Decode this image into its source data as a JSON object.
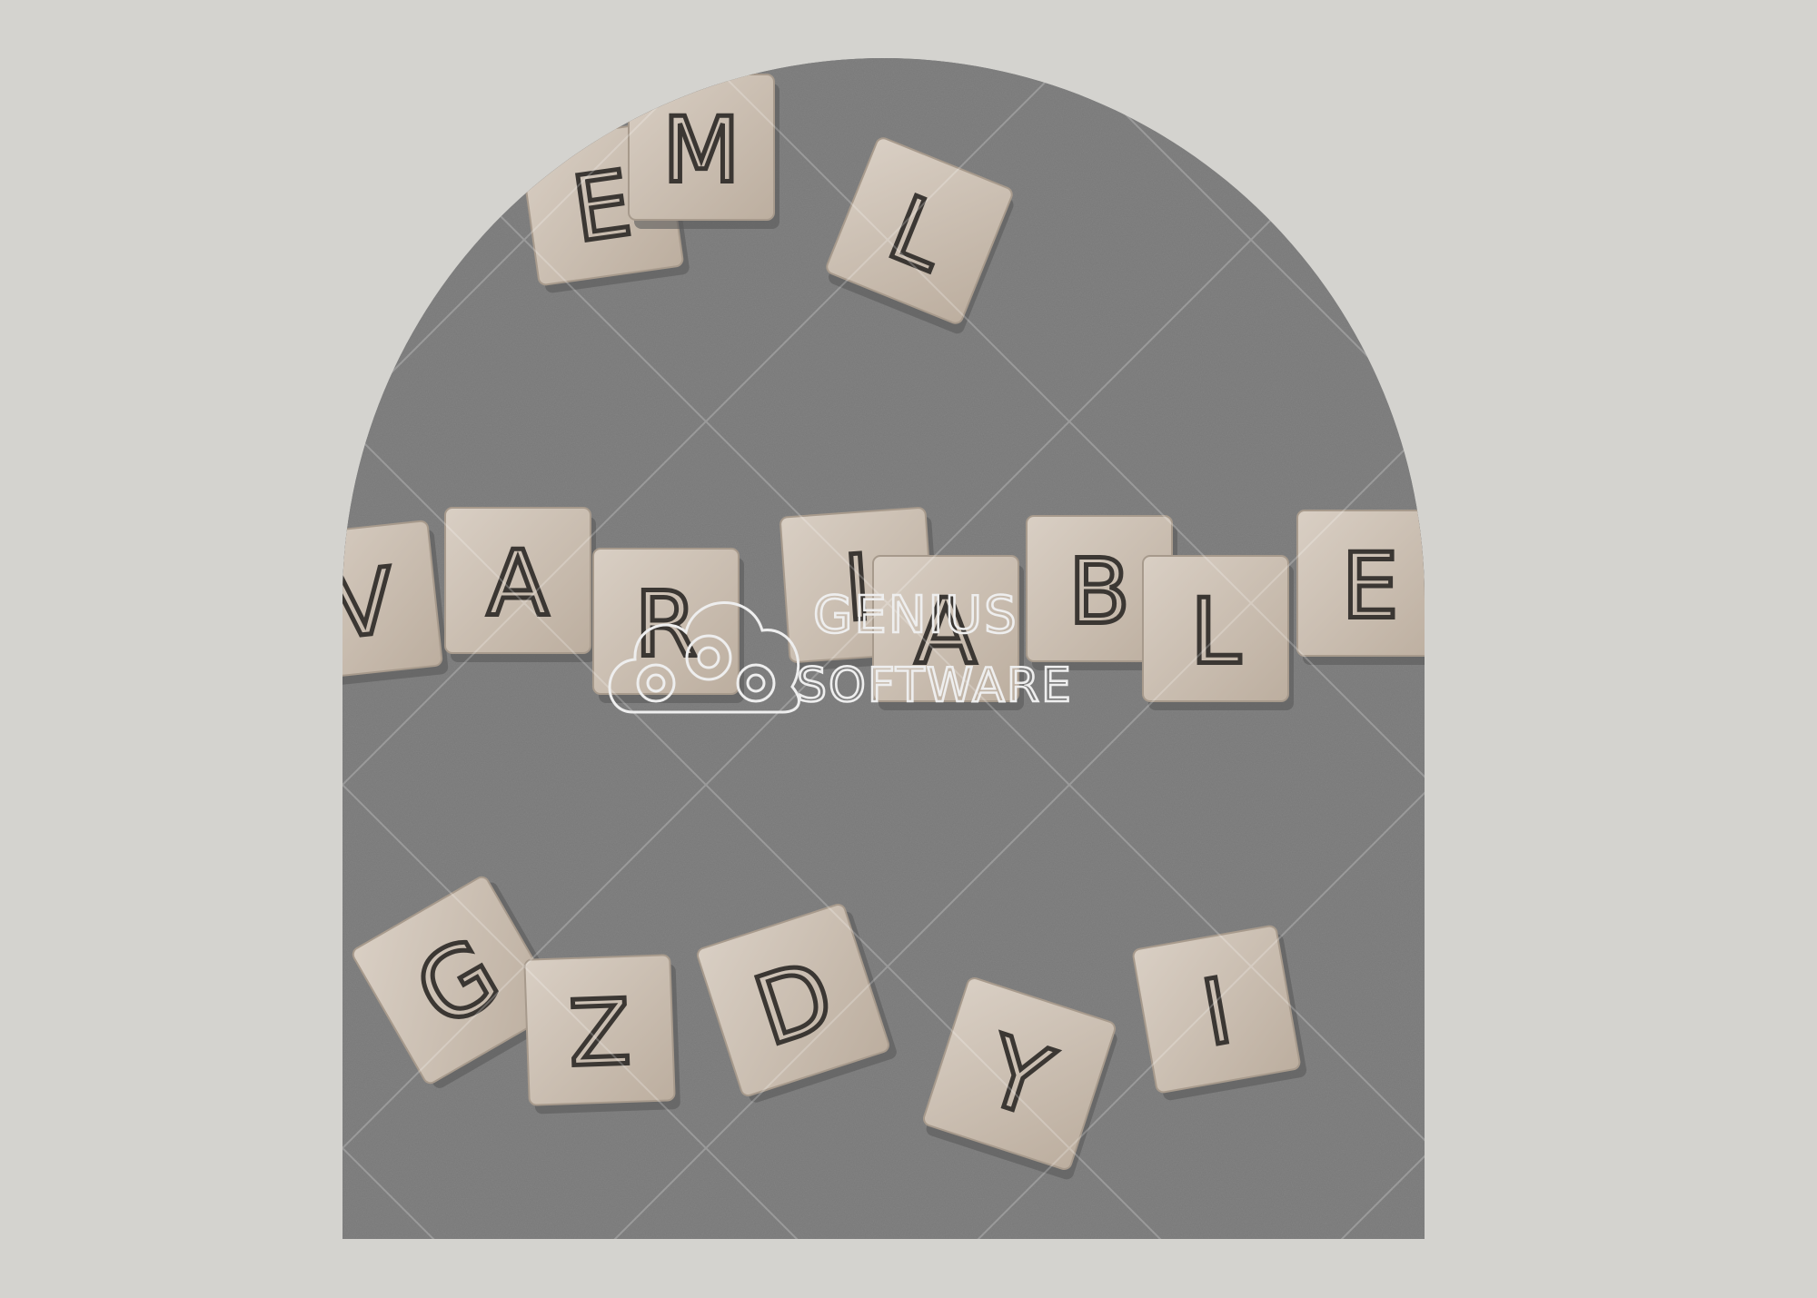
{
  "photo": {
    "subject": "wooden letter blocks on a grey surface",
    "background_color": "#7a7a7a",
    "tile_color": "#cfc3b6",
    "letter_color": "#3b3733",
    "tiles": [
      {
        "letter": "E"
      },
      {
        "letter": "M"
      },
      {
        "letter": "L"
      },
      {
        "letter": "V"
      },
      {
        "letter": "A"
      },
      {
        "letter": "R"
      },
      {
        "letter": "I"
      },
      {
        "letter": "A"
      },
      {
        "letter": "B"
      },
      {
        "letter": "L"
      },
      {
        "letter": "E"
      },
      {
        "letter": "G"
      },
      {
        "letter": "Z"
      },
      {
        "letter": "D"
      },
      {
        "letter": "Y"
      },
      {
        "letter": "I"
      }
    ]
  },
  "watermark": {
    "line1": "GENIUS",
    "line2": "SOFTWARE",
    "icon": "cloud-gears-icon",
    "color": "#eeeeee"
  },
  "page": {
    "background_color": "#d4d3cf"
  }
}
